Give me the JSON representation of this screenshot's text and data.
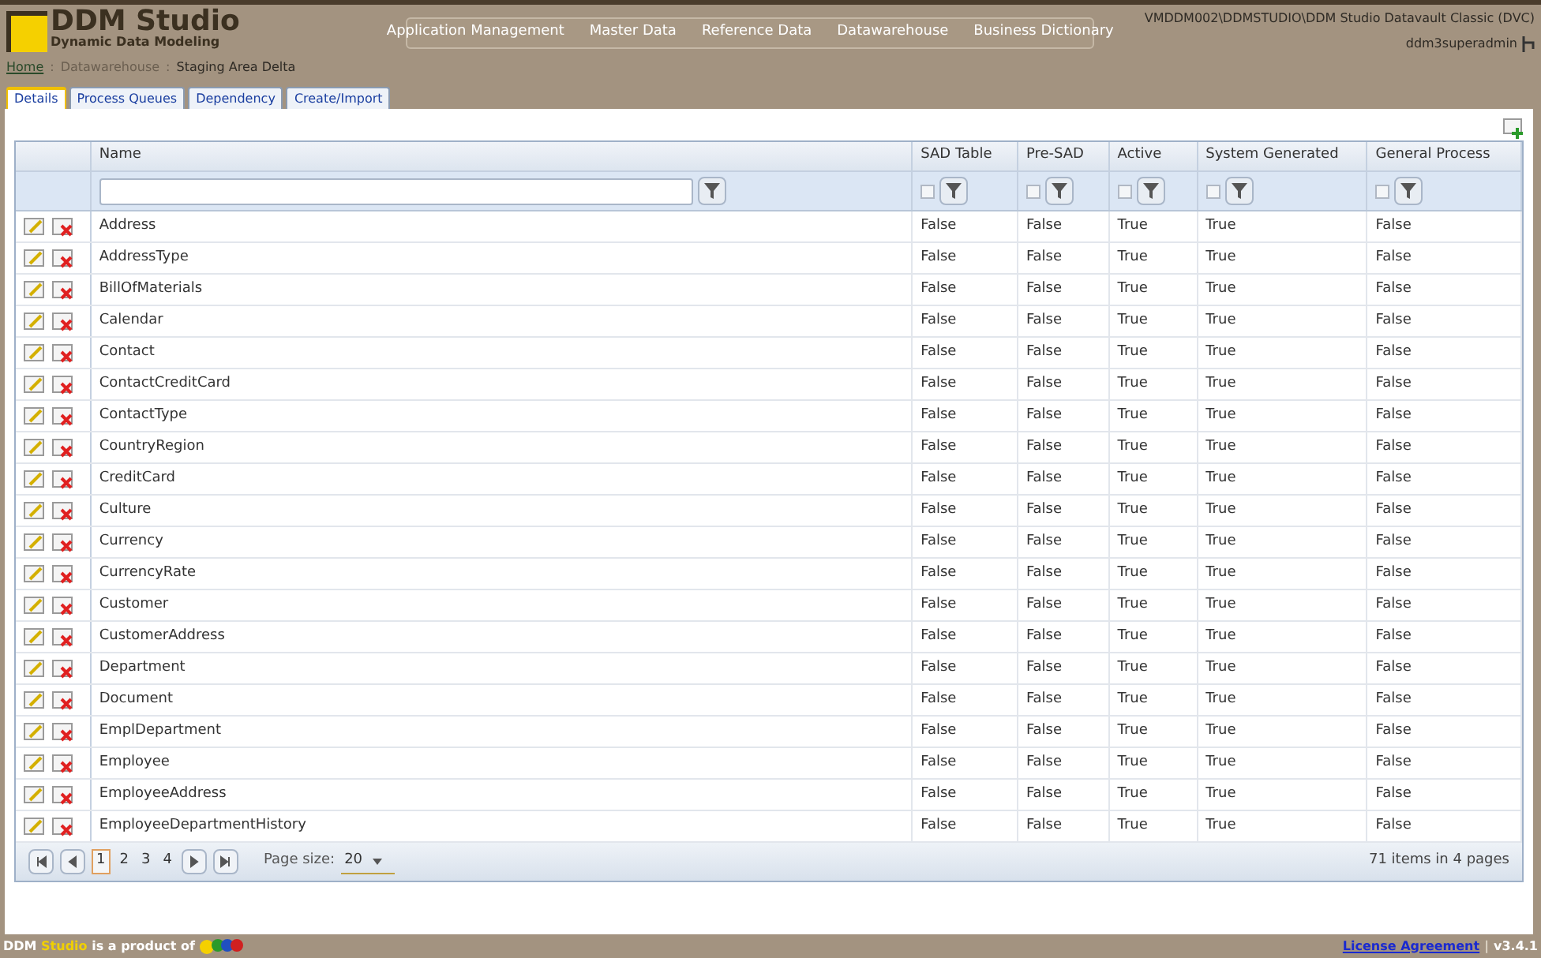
{
  "header": {
    "logo_title": "DDM Studio",
    "logo_subtitle": "Dynamic Data Modeling",
    "nav": [
      "Application Management",
      "Master Data",
      "Reference Data",
      "Datawarehouse",
      "Business Dictionary"
    ],
    "connection": "VMDDM002\\DDMSTUDIO\\DDM Studio Datavault Classic (DVC)",
    "user": "ddm3superadmin"
  },
  "breadcrumb": {
    "link": "Home",
    "items": [
      "Datawarehouse",
      "Staging Area Delta"
    ],
    "separator": ":"
  },
  "tabs": [
    {
      "label": "Details",
      "selected": true
    },
    {
      "label": "Process Queues",
      "selected": false
    },
    {
      "label": "Dependency",
      "selected": false
    },
    {
      "label": "Create/Import",
      "selected": false
    }
  ],
  "table": {
    "columns": [
      {
        "label": "Name",
        "kind": "text"
      },
      {
        "label": "SAD Table",
        "kind": "check",
        "checked": false
      },
      {
        "label": "Pre-SAD",
        "kind": "check",
        "checked": false
      },
      {
        "label": "Active",
        "kind": "check",
        "checked": false
      },
      {
        "label": "System Generated",
        "kind": "check",
        "checked": false
      },
      {
        "label": "General Process",
        "kind": "check",
        "checked": false
      }
    ],
    "rows": [
      [
        "Address",
        "False",
        "False",
        "True",
        "True",
        "False"
      ],
      [
        "AddressType",
        "False",
        "False",
        "True",
        "True",
        "False"
      ],
      [
        "BillOfMaterials",
        "False",
        "False",
        "True",
        "True",
        "False"
      ],
      [
        "Calendar",
        "False",
        "False",
        "True",
        "True",
        "False"
      ],
      [
        "Contact",
        "False",
        "False",
        "True",
        "True",
        "False"
      ],
      [
        "ContactCreditCard",
        "False",
        "False",
        "True",
        "True",
        "False"
      ],
      [
        "ContactType",
        "False",
        "False",
        "True",
        "True",
        "False"
      ],
      [
        "CountryRegion",
        "False",
        "False",
        "True",
        "True",
        "False"
      ],
      [
        "CreditCard",
        "False",
        "False",
        "True",
        "True",
        "False"
      ],
      [
        "Culture",
        "False",
        "False",
        "True",
        "True",
        "False"
      ],
      [
        "Currency",
        "False",
        "False",
        "True",
        "True",
        "False"
      ],
      [
        "CurrencyRate",
        "False",
        "False",
        "True",
        "True",
        "False"
      ],
      [
        "Customer",
        "False",
        "False",
        "True",
        "True",
        "False"
      ],
      [
        "CustomerAddress",
        "False",
        "False",
        "True",
        "True",
        "False"
      ],
      [
        "Department",
        "False",
        "False",
        "True",
        "True",
        "False"
      ],
      [
        "Document",
        "False",
        "False",
        "True",
        "True",
        "False"
      ],
      [
        "EmplDepartment",
        "False",
        "False",
        "True",
        "True",
        "False"
      ],
      [
        "Employee",
        "False",
        "False",
        "True",
        "True",
        "False"
      ],
      [
        "EmployeeAddress",
        "False",
        "False",
        "True",
        "True",
        "False"
      ],
      [
        "EmployeeDepartmentHistory",
        "False",
        "False",
        "True",
        "True",
        "False"
      ]
    ],
    "pager": {
      "pages": [
        {
          "label": "1",
          "selected": true
        },
        {
          "label": "2",
          "selected": false
        },
        {
          "label": "3",
          "selected": false
        },
        {
          "label": "4",
          "selected": false
        }
      ],
      "page_size_label": "Page size:",
      "page_size": "20",
      "summary": "71 items in 4 pages"
    }
  },
  "footer": {
    "product_a": "DDM",
    "product_b": "Studio",
    "text": "is a product of",
    "license": "License Agreement",
    "separator": "|",
    "version": "v3.4.1"
  }
}
